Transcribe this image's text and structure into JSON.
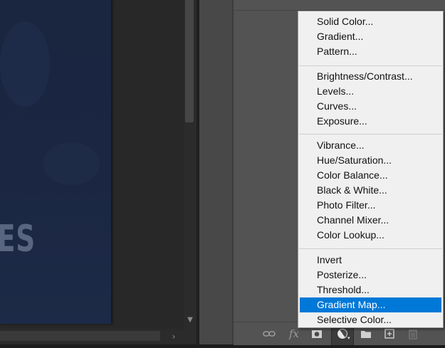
{
  "canvas": {
    "visible_text": "ES"
  },
  "layers_panel": {
    "footer_icons": [
      "link-icon",
      "fx-icon",
      "mask-icon",
      "adjustment-layer-icon",
      "group-folder-icon",
      "new-layer-icon",
      "trash-icon"
    ],
    "fx_label": "fx"
  },
  "adjustment_menu": {
    "groups": [
      [
        "Solid Color...",
        "Gradient...",
        "Pattern..."
      ],
      [
        "Brightness/Contrast...",
        "Levels...",
        "Curves...",
        "Exposure..."
      ],
      [
        "Vibrance...",
        "Hue/Saturation...",
        "Color Balance...",
        "Black & White...",
        "Photo Filter...",
        "Channel Mixer...",
        "Color Lookup..."
      ],
      [
        "Invert",
        "Posterize...",
        "Threshold...",
        "Gradient Map...",
        "Selective Color..."
      ]
    ],
    "selected": "Gradient Map..."
  },
  "colors": {
    "menu_bg": "#f0f0f0",
    "selection": "#0078d7",
    "panel_bg": "#535353",
    "canvas_doc": "#1b2742"
  }
}
